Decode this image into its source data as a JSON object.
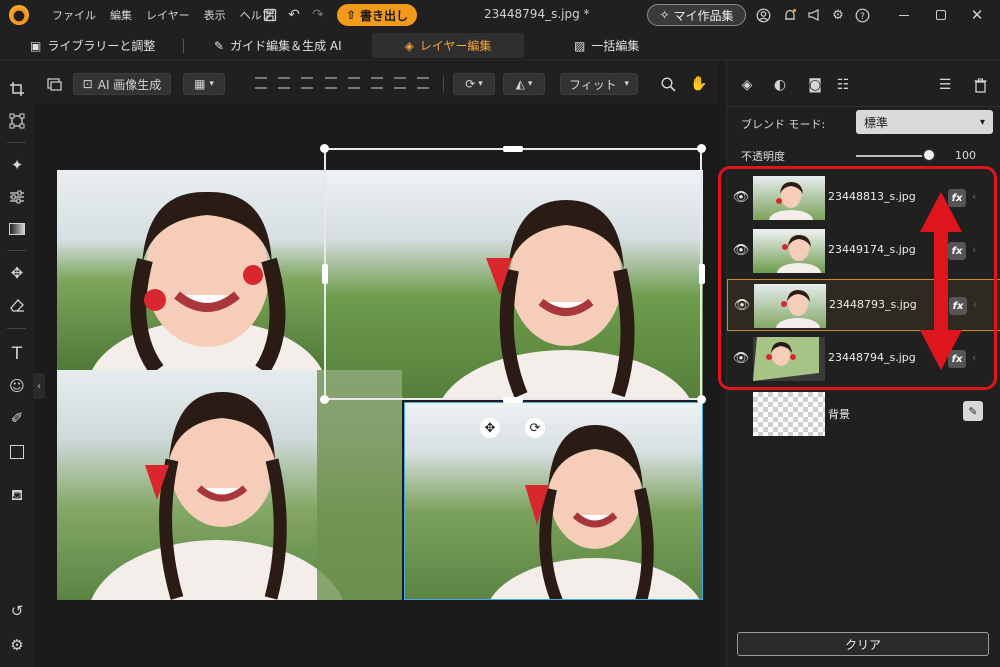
{
  "menu": [
    "ファイル",
    "編集",
    "レイヤー",
    "表示",
    "ヘルプ"
  ],
  "titlebar": {
    "export_label": "書き出し",
    "document_title": "23448794_s.jpg *",
    "my_works_label": "マイ作品集"
  },
  "mode_tabs": [
    {
      "label": "ライブラリーと調整"
    },
    {
      "label": "ガイド編集＆生成 AI"
    },
    {
      "label": "レイヤー編集"
    },
    {
      "label": "一括編集"
    }
  ],
  "canvas_toolbar": {
    "ai_generate_label": "AI 画像生成",
    "fit_label": "フィット"
  },
  "right_panel": {
    "blend_mode_label": "ブレンド モード:",
    "blend_mode_value": "標準",
    "opacity_label": "不透明度",
    "opacity_value": "100",
    "clear_label": "クリア"
  },
  "layers": [
    {
      "name": "23448813_s.jpg",
      "selected": false
    },
    {
      "name": "23449174_s.jpg",
      "selected": false
    },
    {
      "name": "23448793_s.jpg",
      "selected": true
    },
    {
      "name": "23448794_s.jpg",
      "selected": false
    },
    {
      "name": "背景",
      "selected": false
    }
  ],
  "colors": {
    "accent": "#f39a1b",
    "highlight": "#e0161e",
    "arrow": "#e0161e",
    "selection": "#e8e8e8",
    "secondary_selection": "#4aa8e0"
  }
}
